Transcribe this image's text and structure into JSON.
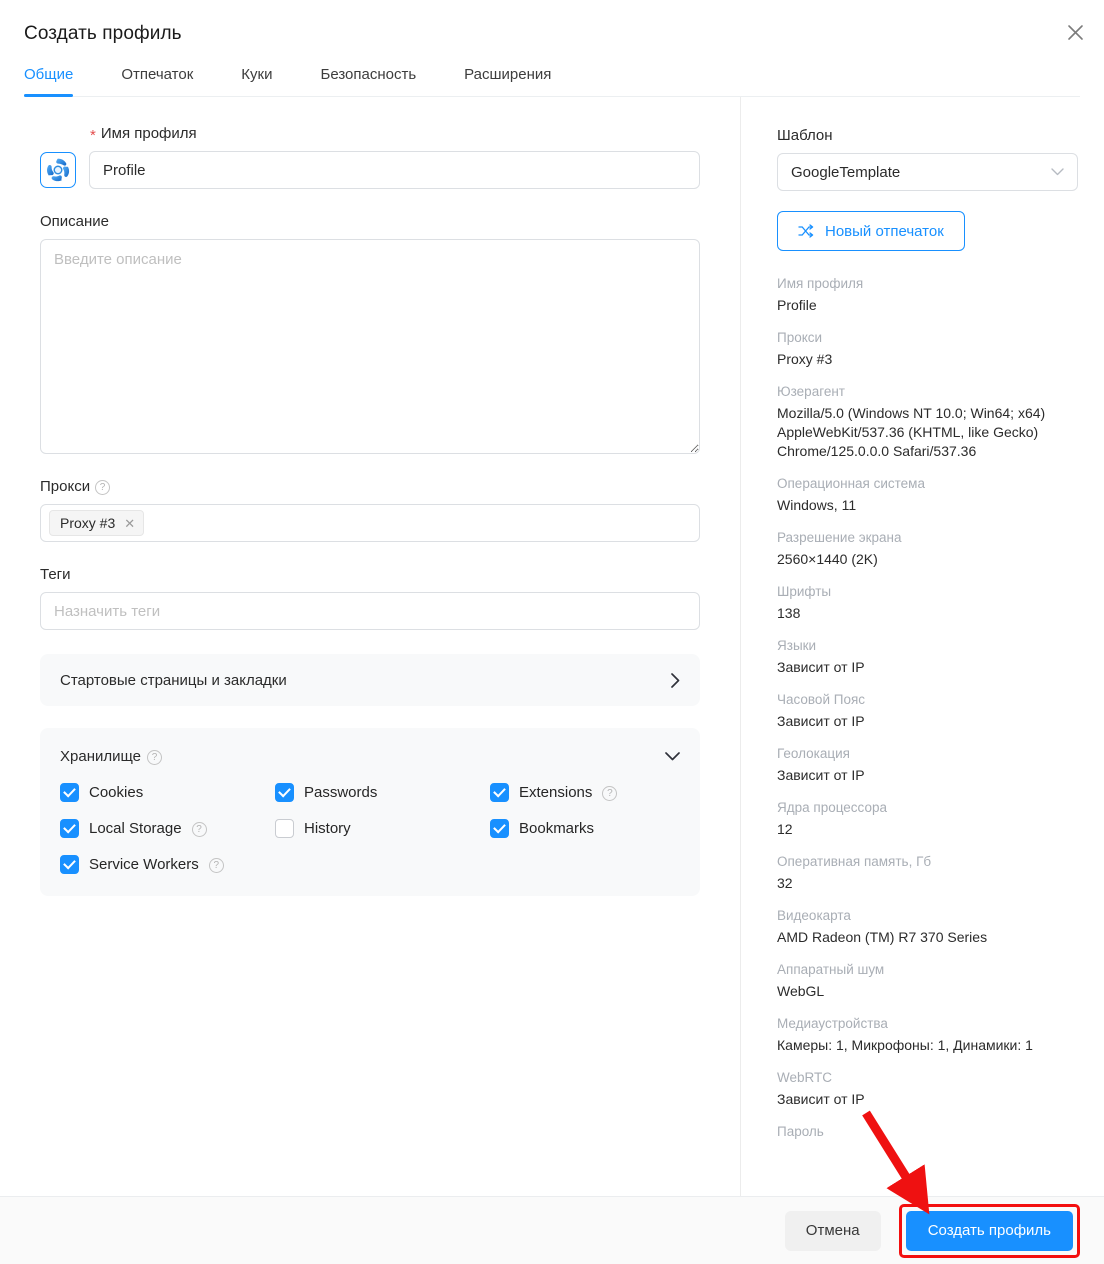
{
  "header": {
    "title": "Создать профиль",
    "close_icon": "close-icon"
  },
  "tabs": [
    {
      "label": "Общие",
      "active": true
    },
    {
      "label": "Отпечаток",
      "active": false
    },
    {
      "label": "Куки",
      "active": false
    },
    {
      "label": "Безопасность",
      "active": false
    },
    {
      "label": "Расширения",
      "active": false
    }
  ],
  "form": {
    "profile_name": {
      "label": "Имя профиля",
      "required_marker": "*",
      "value": "Profile",
      "avatar_icon": "profile-avatar-icon"
    },
    "description": {
      "label": "Описание",
      "placeholder": "Введите описание",
      "value": ""
    },
    "proxy": {
      "label": "Прокси",
      "help_icon": "help-icon",
      "token": "Proxy #3",
      "token_remove_icon": "close-small-icon"
    },
    "tags": {
      "label": "Теги",
      "placeholder": "Назначить теги",
      "value": ""
    },
    "startpages": {
      "label": "Стартовые страницы и закладки",
      "chevron_icon": "chevron-right-icon"
    },
    "storage": {
      "label": "Хранилище",
      "help_icon": "help-icon",
      "collapse_icon": "chevron-down-icon",
      "items": [
        {
          "label": "Cookies",
          "checked": true,
          "has_help": false
        },
        {
          "label": "Passwords",
          "checked": true,
          "has_help": false
        },
        {
          "label": "Extensions",
          "checked": true,
          "has_help": true
        },
        {
          "label": "Local Storage",
          "checked": true,
          "has_help": true
        },
        {
          "label": "History",
          "checked": false,
          "has_help": false
        },
        {
          "label": "Bookmarks",
          "checked": true,
          "has_help": false
        },
        {
          "label": "Service Workers",
          "checked": true,
          "has_help": true
        }
      ]
    }
  },
  "sidebar": {
    "template_label": "Шаблон",
    "template_value": "GoogleTemplate",
    "template_chevron_icon": "chevron-down-icon",
    "new_fingerprint_button": "Новый отпечаток",
    "new_fingerprint_icon": "shuffle-icon",
    "info": [
      {
        "key": "Имя профиля",
        "value": "Profile"
      },
      {
        "key": "Прокси",
        "value": "Proxy #3"
      },
      {
        "key": "Юзерагент",
        "value": "Mozilla/5.0 (Windows NT 10.0; Win64; x64) AppleWebKit/537.36 (KHTML, like Gecko) Chrome/125.0.0.0 Safari/537.36"
      },
      {
        "key": "Операционная система",
        "value": "Windows, 11"
      },
      {
        "key": "Разрешение экрана",
        "value": "2560×1440 (2K)"
      },
      {
        "key": "Шрифты",
        "value": "138"
      },
      {
        "key": "Языки",
        "value": "Зависит от IP"
      },
      {
        "key": "Часовой Пояс",
        "value": "Зависит от IP"
      },
      {
        "key": "Геолокация",
        "value": "Зависит от IP"
      },
      {
        "key": "Ядра процессора",
        "value": "12"
      },
      {
        "key": "Оперативная память, Гб",
        "value": "32"
      },
      {
        "key": "Видеокарта",
        "value": "AMD Radeon (TM) R7 370 Series"
      },
      {
        "key": "Аппаратный шум",
        "value": "WebGL"
      },
      {
        "key": "Медиаустройства",
        "value": "Камеры: 1, Микрофоны: 1, Динамики: 1"
      },
      {
        "key": "WebRTC",
        "value": "Зависит от IP"
      },
      {
        "key": "Пароль",
        "value": ""
      }
    ]
  },
  "footer": {
    "cancel_label": "Отмена",
    "submit_label": "Создать профиль"
  },
  "annotation": {
    "arrow_color": "#ef1111",
    "highlight_color": "#f30f0f"
  },
  "colors": {
    "accent": "#1890ff",
    "required": "#e34d4d",
    "panel_bg": "#f8f9fa"
  }
}
